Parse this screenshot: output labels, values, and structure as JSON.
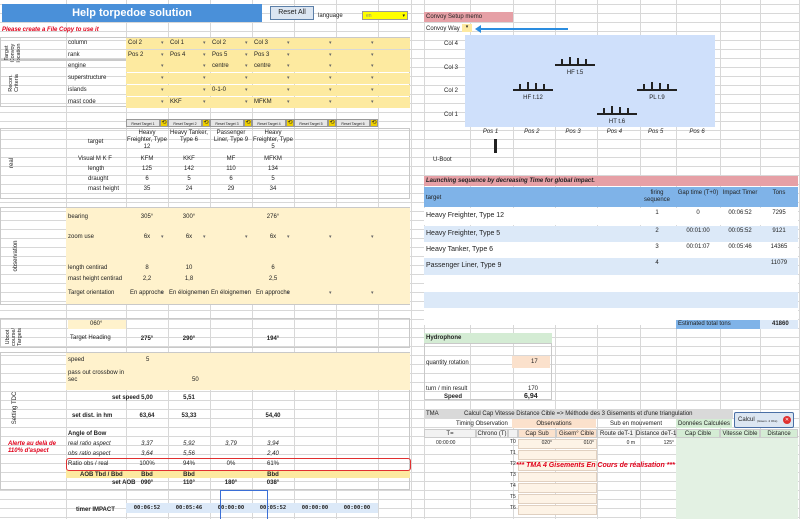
{
  "header": {
    "title": "Help torpedoe solution",
    "reset_all": "Reset All",
    "language_label": "language",
    "language_value": "en",
    "warning": "Please create a File Copy to use it"
  },
  "target_section": {
    "label": "Target\nConvoy\nlocation",
    "rows": [
      {
        "label": "column",
        "values": [
          "Col 2",
          "Col 1",
          "Col 2",
          "Col 3",
          "",
          ""
        ]
      },
      {
        "label": "rank",
        "values": [
          "Pos 2",
          "Pos 4",
          "Pos 5",
          "Pos 3",
          "",
          ""
        ]
      }
    ]
  },
  "recon_section": {
    "label": "Recon.\nCriteria",
    "rows": [
      {
        "label": "engine",
        "values": [
          "",
          "",
          "centre",
          "centre",
          "",
          ""
        ]
      },
      {
        "label": "superstructure",
        "values": [
          "",
          "",
          "",
          "",
          "",
          ""
        ]
      },
      {
        "label": "islands",
        "values": [
          "",
          "",
          "0-1-0",
          "",
          "",
          ""
        ]
      },
      {
        "label": "mast code",
        "values": [
          "",
          "KKF",
          "",
          "MFKM",
          "",
          ""
        ]
      }
    ]
  },
  "reset_targets": [
    "Reset Target 1",
    "Reset Target 2",
    "Reset Target 3",
    "Reset Target 4",
    "Reset Target 5",
    "Reset Target 6"
  ],
  "real_section": {
    "label": "real",
    "target_label": "target",
    "targets": [
      "Heavy Freighter, Type 12",
      "Heavy Tanker, Type 6",
      "Passenger Liner, Type 9",
      "Heavy Freighter, Type 5",
      "",
      ""
    ],
    "rows": [
      {
        "label": "Visual M K F",
        "values": [
          "KFM",
          "KKF",
          "MF",
          "MFKM",
          "",
          ""
        ]
      },
      {
        "label": "length",
        "values": [
          "125",
          "142",
          "110",
          "134",
          "",
          ""
        ]
      },
      {
        "label": "draught",
        "values": [
          "6",
          "5",
          "6",
          "5",
          "",
          ""
        ]
      },
      {
        "label": "mast height",
        "values": [
          "35",
          "24",
          "29",
          "34",
          "",
          ""
        ]
      }
    ]
  },
  "observation_section": {
    "label": "observation",
    "rows": [
      {
        "label": "bearing",
        "values": [
          "305°",
          "300°",
          "",
          "276°",
          "",
          ""
        ]
      },
      {
        "label": "zoom use",
        "values": [
          "6x",
          "6x",
          "",
          "6x",
          "",
          ""
        ]
      },
      {
        "label": "length centirad",
        "values": [
          "8",
          "10",
          "",
          "6",
          "",
          ""
        ]
      },
      {
        "label": "mast height centirad",
        "values": [
          "2,2",
          "1,8",
          "",
          "2,5",
          "",
          ""
        ]
      },
      {
        "label": "Target orientation",
        "values": [
          "En approche",
          "En éloignemen",
          "En éloignemen",
          "En approche",
          "",
          ""
        ]
      }
    ]
  },
  "uboat_section": {
    "label": "Uboot\ncourse/\nTargets",
    "course": "060°",
    "heading_label": "Target Heading",
    "headings": [
      "275°",
      "290°",
      "",
      "194°",
      "",
      ""
    ]
  },
  "tdc_section": {
    "label": "Setting TDC",
    "speed_label": "speed",
    "speed_value": "5",
    "pass_label": "pass out crossbow in sec",
    "pass_value": "50",
    "set_speed_label": "set speed",
    "set_speed_values": [
      "5,00",
      "5,51",
      "",
      "",
      "",
      ""
    ],
    "set_dist_label": "set dist. in hm",
    "set_dist_values": [
      "63,64",
      "53,33",
      "",
      "54,40",
      "",
      ""
    ],
    "angle_label": "Angle of Bow",
    "real_ratio_label": "real ratio aspect",
    "real_ratio_values": [
      "3,37",
      "5,92",
      "3,79",
      "3,94",
      "",
      ""
    ],
    "obs_ratio_label": "obs ratio aspect",
    "obs_ratio_values": [
      "3,64",
      "5,56",
      "",
      "2,40",
      "",
      ""
    ],
    "ratio_label": "Ratio obs / real",
    "ratio_values": [
      "100%",
      "94%",
      "0%",
      "61%",
      "",
      ""
    ],
    "aob_label": "AOB Tbd / Bbd",
    "aob_values": [
      "Bbd",
      "Bbd",
      "",
      "Bbd",
      "",
      ""
    ],
    "set_aob_label": "set AOB",
    "set_aob_values": [
      "090°",
      "110°",
      "180°",
      "038°",
      "",
      ""
    ],
    "alert": "Alerte au delà de 110% d'aspect",
    "timer_label": "timer IMPACT",
    "timer_values": [
      "00:06:52",
      "00:05:46",
      "00:00:00",
      "00:05:52",
      "00:00:00",
      "00:00:00"
    ]
  },
  "convoy_memo": {
    "title": "Convoy Setup memo",
    "convoy_way_label": "Convoy Way",
    "columns": [
      "Col 4",
      "Col 3",
      "Col 2",
      "Col 1"
    ],
    "positions": [
      "Pos 1",
      "Pos 2",
      "Pos 3",
      "Pos 4",
      "Pos 5",
      "Pos 6"
    ],
    "ships": [
      {
        "label": "HF t.5"
      },
      {
        "label": "HF t.12"
      },
      {
        "label": "PL t.9"
      },
      {
        "label": "HT t.6"
      }
    ],
    "uboot_label": "U-Boot"
  },
  "launch": {
    "title": "Launching sequence by decreasing Time for global impact.",
    "headers": [
      "target",
      "firing sequence",
      "Gap time (T+0)",
      "Impact Timer",
      "Tons"
    ],
    "rows": [
      {
        "target": "Heavy Freighter, Type 12",
        "seq": "1",
        "gap": "0",
        "timer": "00:06:52",
        "tons": "7295"
      },
      {
        "target": "Heavy Freighter, Type 5",
        "seq": "2",
        "gap": "00:01:00",
        "timer": "00:05:52",
        "tons": "9121"
      },
      {
        "target": "Heavy Tanker, Type 6",
        "seq": "3",
        "gap": "00:01:07",
        "timer": "00:05:46",
        "tons": "14365"
      },
      {
        "target": "Passenger Liner, Type 9",
        "seq": "4",
        "gap": "",
        "timer": "",
        "tons": "11079"
      }
    ],
    "total_label": "Estimated total tons",
    "total_value": "41860"
  },
  "hydrophone": {
    "title": "Hydrophone",
    "qty_label": "quantity rotation",
    "qty_value": "17",
    "turn_label": "turn / min result",
    "turn_value": "170",
    "speed_label": "Speed",
    "speed_value": "6,94"
  },
  "tma": {
    "tma_label": "TMA",
    "title": "Calcul Cap Vitesse Distance Cible => Méthode des 3 Gisements et d'une triangulation",
    "calc_button": "Calcul",
    "calc_sub": "(Gisem. 4 Obs)",
    "timing": "Timing Observation",
    "observations": "Observations",
    "sub_move": "Sub en mouvement",
    "donnees": "Données Calculées",
    "cols": [
      "T=",
      "Chrono (T)",
      "",
      "Cap Sub",
      "Gisem° Cible",
      "Route deT-1",
      "Distance deT-1",
      "Cap Cible",
      "Vitesse Cible",
      "Distance"
    ],
    "row_labels": [
      "T0",
      "T1",
      "T2",
      "T3",
      "T4",
      "T5",
      "T6"
    ],
    "row0": {
      "t": "00:00:00",
      "cap": "020°",
      "gis": "010°",
      "route": "0 m",
      "dist": "125°"
    },
    "status": "*** TMA 4 Gisements En Cours de réalisation ***"
  }
}
